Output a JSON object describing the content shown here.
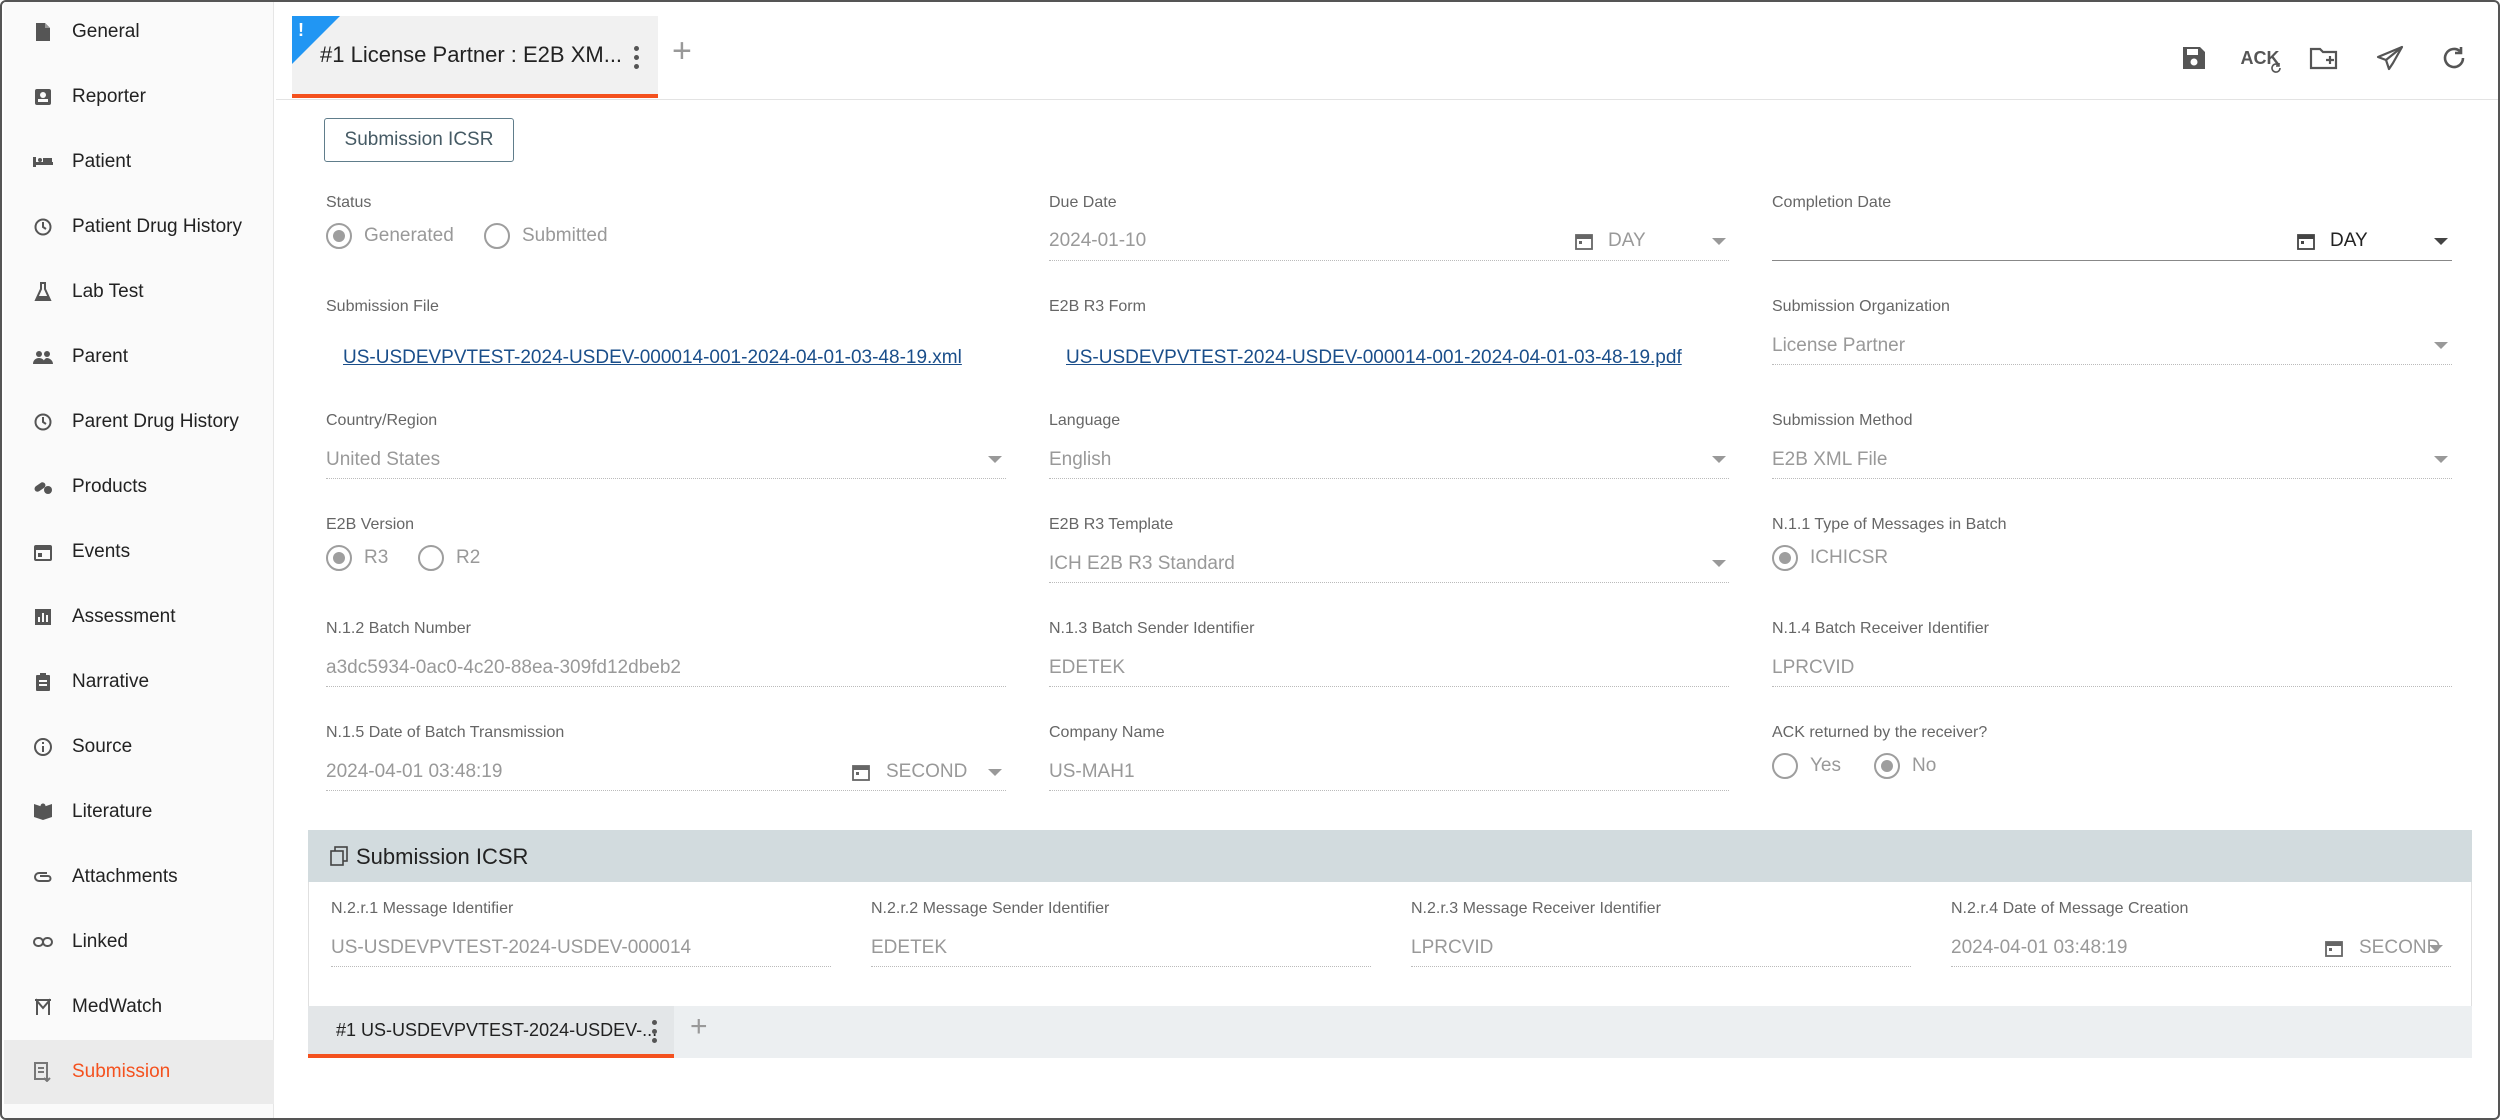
{
  "sidebar": {
    "items": [
      {
        "label": "General",
        "icon": "document-icon"
      },
      {
        "label": "Reporter",
        "icon": "contact-card-icon"
      },
      {
        "label": "Patient",
        "icon": "patient-bed-icon"
      },
      {
        "label": "Patient Drug History",
        "icon": "history-icon"
      },
      {
        "label": "Lab Test",
        "icon": "lab-flask-icon"
      },
      {
        "label": "Parent",
        "icon": "people-icon"
      },
      {
        "label": "Parent Drug History",
        "icon": "history-icon"
      },
      {
        "label": "Products",
        "icon": "pills-icon"
      },
      {
        "label": "Events",
        "icon": "calendar-icon"
      },
      {
        "label": "Assessment",
        "icon": "bar-chart-icon"
      },
      {
        "label": "Narrative",
        "icon": "clipboard-icon"
      },
      {
        "label": "Source",
        "icon": "info-icon"
      },
      {
        "label": "Literature",
        "icon": "book-icon"
      },
      {
        "label": "Attachments",
        "icon": "paperclip-icon"
      },
      {
        "label": "Linked",
        "icon": "link-icon"
      },
      {
        "label": "MedWatch",
        "icon": "medwatch-icon"
      },
      {
        "label": "Submission",
        "icon": "submission-icon",
        "active": true
      }
    ]
  },
  "header": {
    "tab_flag": "!",
    "tab_title": "#1 License Partner : E2B XM...",
    "add_tab": "+",
    "toolbar": {
      "ack_label": "ACK"
    }
  },
  "form": {
    "submit_button": "Submission ICSR",
    "status": {
      "label": "Status",
      "options": [
        "Generated",
        "Submitted"
      ],
      "selected": "Generated"
    },
    "due_date": {
      "label": "Due Date",
      "value": "2024-01-10",
      "unit": "DAY"
    },
    "completion_date": {
      "label": "Completion Date",
      "value": "",
      "unit": "DAY"
    },
    "submission_file": {
      "label": "Submission File",
      "value": "US-USDEVPVTEST-2024-USDEV-000014-001-2024-04-01-03-48-19.xml"
    },
    "e2b_form": {
      "label": "E2B R3 Form",
      "value": "US-USDEVPVTEST-2024-USDEV-000014-001-2024-04-01-03-48-19.pdf"
    },
    "submission_org": {
      "label": "Submission Organization",
      "value": "License Partner"
    },
    "country": {
      "label": "Country/Region",
      "value": "United States"
    },
    "language": {
      "label": "Language",
      "value": "English"
    },
    "method": {
      "label": "Submission Method",
      "value": "E2B XML File"
    },
    "e2b_version": {
      "label": "E2B Version",
      "options": [
        "R3",
        "R2"
      ],
      "selected": "R3"
    },
    "e2b_template": {
      "label": "E2B R3 Template",
      "value": "ICH E2B R3 Standard"
    },
    "message_type": {
      "label": "N.1.1 Type of Messages in Batch",
      "option": "ICHICSR"
    },
    "batch_number": {
      "label": "N.1.2 Batch Number",
      "value": "a3dc5934-0ac0-4c20-88ea-309fd12dbeb2"
    },
    "batch_sender": {
      "label": "N.1.3 Batch Sender Identifier",
      "value": "EDETEK"
    },
    "batch_receiver": {
      "label": "N.1.4 Batch Receiver Identifier",
      "value": "LPRCVID"
    },
    "batch_date": {
      "label": "N.1.5 Date of Batch Transmission",
      "value": "2024-04-01 03:48:19",
      "unit": "SECOND"
    },
    "company": {
      "label": "Company Name",
      "value": "US-MAH1"
    },
    "ack": {
      "label": "ACK returned by the receiver?",
      "options": [
        "Yes",
        "No"
      ],
      "selected": "No"
    }
  },
  "panel": {
    "title": "Submission ICSR",
    "msg_id": {
      "label": "N.2.r.1 Message Identifier",
      "value": "US-USDEVPVTEST-2024-USDEV-000014"
    },
    "msg_sender": {
      "label": "N.2.r.2 Message Sender Identifier",
      "value": "EDETEK"
    },
    "msg_receiver": {
      "label": "N.2.r.3 Message Receiver Identifier",
      "value": "LPRCVID"
    },
    "msg_date": {
      "label": "N.2.r.4 Date of Message Creation",
      "value": "2024-04-01 03:48:19",
      "unit": "SECOND"
    },
    "subtab_title": "#1 US-USDEVPVTEST-2024-USDEV-...",
    "add_subtab": "+"
  }
}
